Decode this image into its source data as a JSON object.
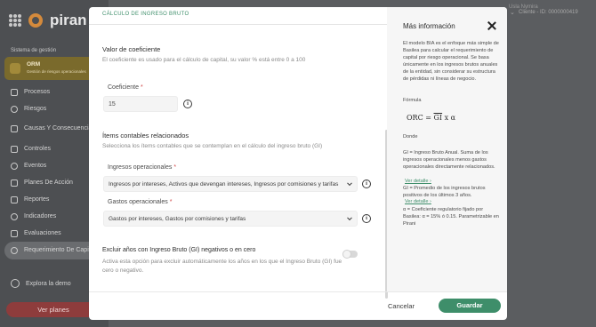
{
  "app": {
    "logo_text": "piran",
    "system_label": "Sistema de gestión",
    "module": {
      "title": "ORM",
      "subtitle": "Gestión de riesgos operacionales"
    },
    "nav": [
      {
        "label": "Procesos",
        "icon": "process-icon"
      },
      {
        "label": "Riesgos",
        "icon": "alert-icon"
      },
      {
        "label": "Causas Y Consecuencias",
        "icon": "cause-icon"
      },
      {
        "label": "Controles",
        "icon": "sliders-icon"
      },
      {
        "label": "Eventos",
        "icon": "bolt-icon"
      },
      {
        "label": "Planes De Acción",
        "icon": "checklist-icon"
      },
      {
        "label": "Reportes",
        "icon": "report-icon"
      },
      {
        "label": "Indicadores",
        "icon": "indicator-icon"
      },
      {
        "label": "Evaluaciones",
        "icon": "evaluation-icon"
      },
      {
        "label": "Requerimiento De Capital",
        "icon": "capital-icon"
      }
    ],
    "explore_label": "Explora la demo",
    "plans_button": "Ver planes",
    "user_name": "Usla Nymira",
    "user_id": "Cliente - ID: 0000000419"
  },
  "modal": {
    "header_title": "CÁLCULO DE INGRESO BRUTO",
    "coef_section_title": "Valor de coeficiente",
    "coef_section_desc": "El coeficiente es usado para el cálculo de capital, su valor % está entre 0 a 100",
    "coef_label": "Coeficiente",
    "coef_value": "15",
    "items_section_title": "Ítems contables relacionados",
    "items_section_desc": "Selecciona los ítems contables que se contemplan en el cálculo del ingreso bruto (GI)",
    "income_label": "Ingresos operacionales",
    "income_value": "Ingresos por intereses, Activos que devengan intereses, Ingresos por comisiones y tarifas",
    "expense_label": "Gastos operacionales",
    "expense_value": "Gastos por intereses, Gastos por comisiones y tarifas",
    "exclude_title": "Excluir años con Ingreso Bruto (GI) negativos o en cero",
    "exclude_desc": "Activa esta opción para excluir automáticamente los años en los que el Ingreso Bruto (GI) fue cero o negativo.",
    "exclude_toggle_on": false,
    "cancel_label": "Cancelar",
    "save_label": "Guardar",
    "required_mark": "*",
    "info_glyph": "i"
  },
  "info": {
    "title": "Más información",
    "paragraph": "El modelo BIA es el enfoque más simple de Basilea para calcular el requerimiento de capital por riesgo operacional. Se basa únicamente en los ingresos brutos anuales de la entidad, sin considerar su estructura de pérdidas ni líneas de negocio.",
    "formula_label": "Fórmula",
    "formula_lhs": "ORC =",
    "formula_gi": "GI",
    "formula_rhs": "x α",
    "where_label": "Donde",
    "gi_def": "GI = Ingreso Bruto Anual. Suma de los ingresos operacionales menos gastos operacionales directamente relacionados.",
    "link1": "Ver detalle",
    "gi_bar_def": "GI = Promedio de los ingresos brutos positivos de los últimos 3 años.",
    "link2": "Ver detalle",
    "alpha_def": "α = Coeficiente regulatorio fijado por Basilea: α = 15% ó 0.15. Parametrizable en Pirani"
  }
}
